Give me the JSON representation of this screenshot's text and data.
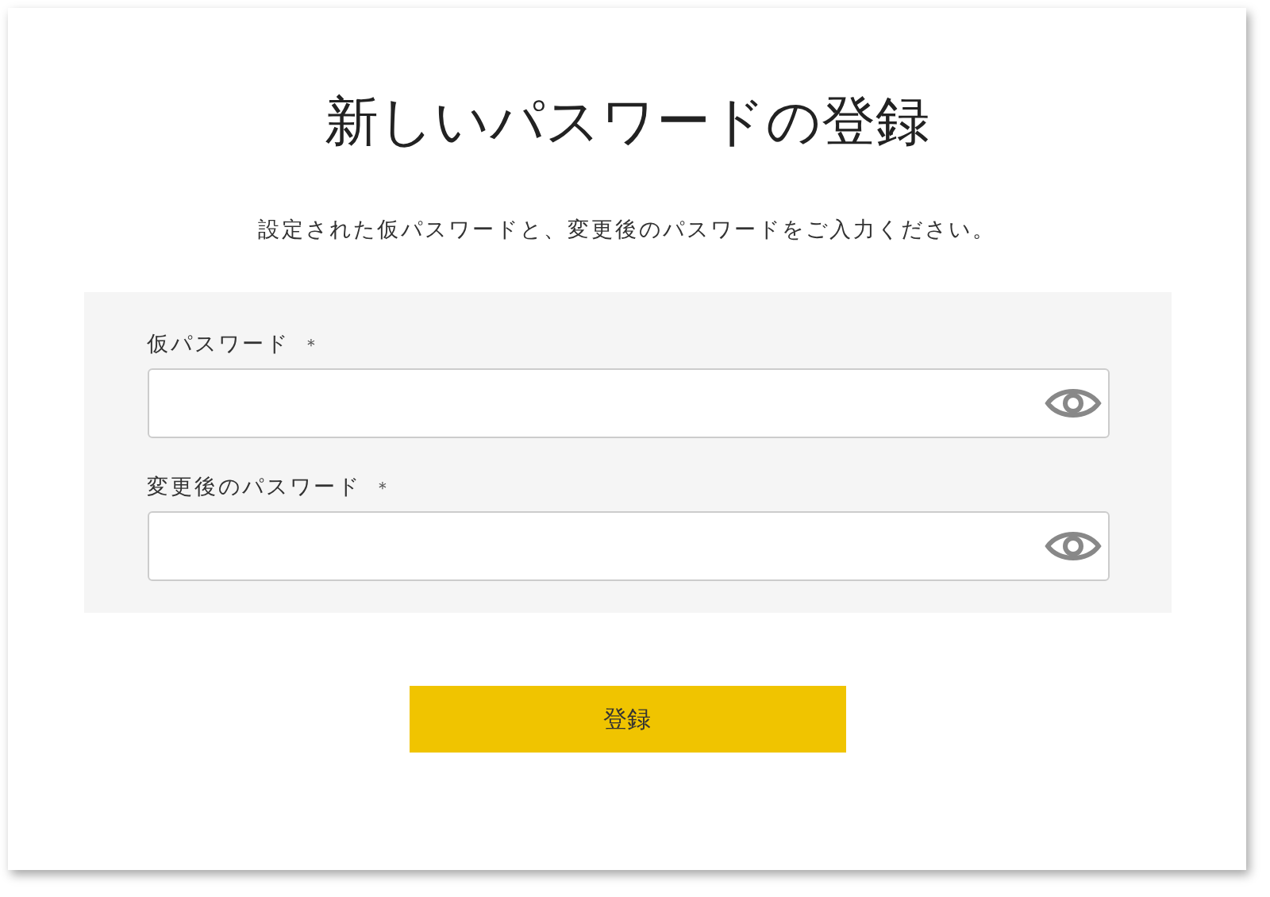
{
  "title": "新しいパスワードの登録",
  "description": "設定された仮パスワードと、変更後のパスワードをご入力ください。",
  "fields": [
    {
      "label": "仮パスワード",
      "required_mark": "＊"
    },
    {
      "label": "変更後のパスワード",
      "required_mark": "＊"
    }
  ],
  "submit_button": "登録"
}
